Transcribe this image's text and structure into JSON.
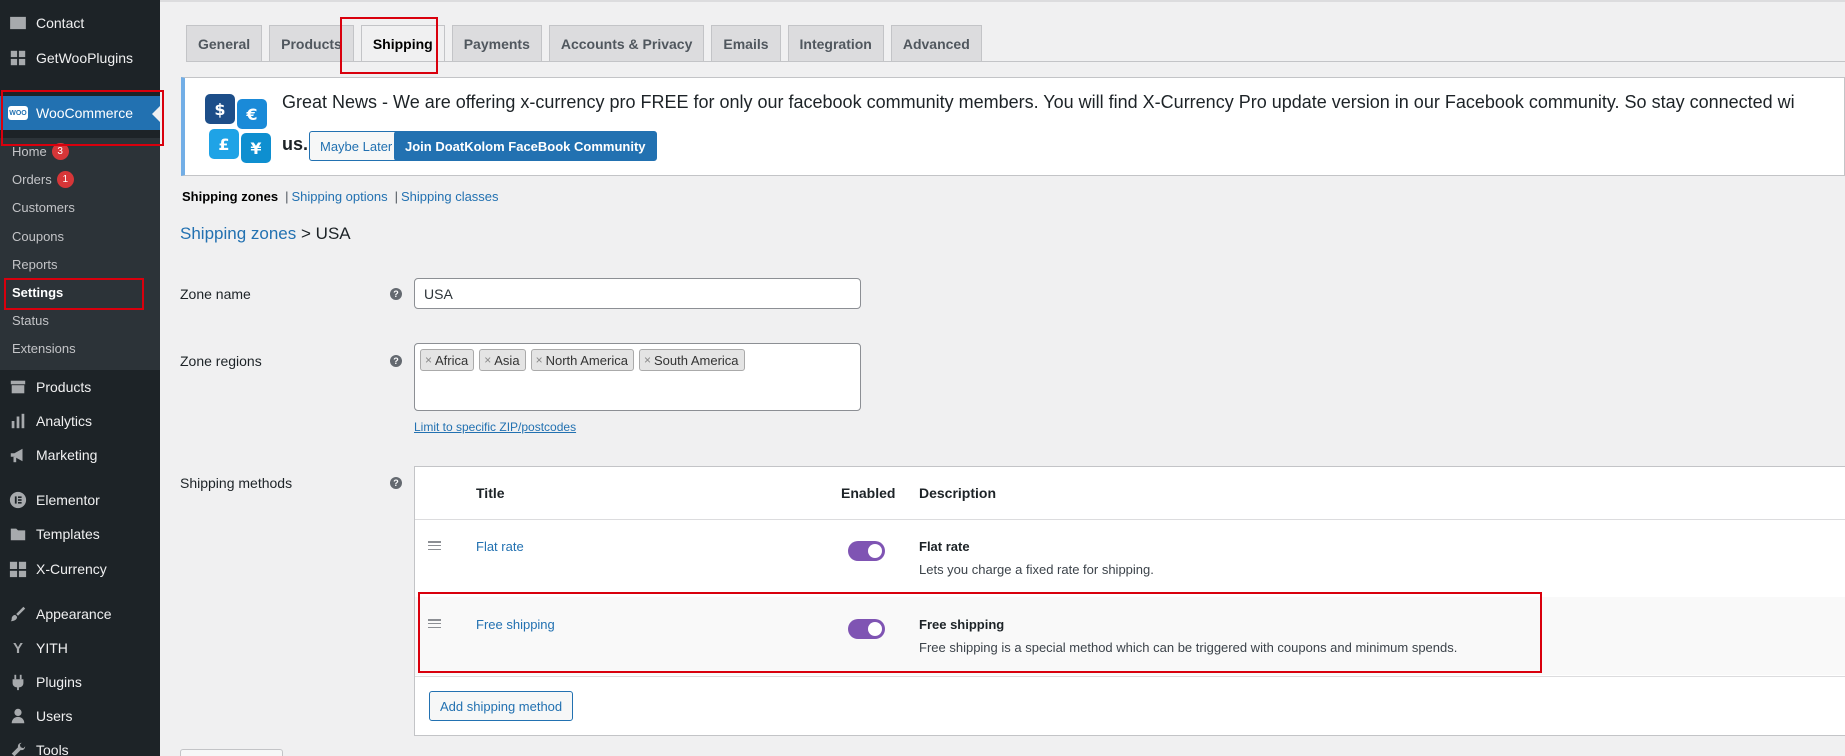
{
  "sidebar": {
    "top_items": [
      {
        "label": "Contact",
        "icon": "mail-icon"
      },
      {
        "label": "GetWooPlugins",
        "icon": "plugin-grid-icon"
      },
      {
        "label": "WooCommerce",
        "icon": "woocommerce-icon",
        "active": true
      }
    ],
    "woo_submenu": [
      {
        "label": "Home",
        "badge": "3"
      },
      {
        "label": "Orders",
        "badge": "1"
      },
      {
        "label": "Customers"
      },
      {
        "label": "Coupons"
      },
      {
        "label": "Reports"
      },
      {
        "label": "Settings",
        "current": true
      },
      {
        "label": "Status"
      },
      {
        "label": "Extensions"
      }
    ],
    "bottom_items": [
      {
        "label": "Products",
        "icon": "archive-icon"
      },
      {
        "label": "Analytics",
        "icon": "bar-chart-icon"
      },
      {
        "label": "Marketing",
        "icon": "megaphone-icon"
      },
      {
        "label": "Elementor",
        "icon": "elementor-icon"
      },
      {
        "label": "Templates",
        "icon": "folder-icon"
      },
      {
        "label": "X-Currency",
        "icon": "currency-icon"
      },
      {
        "label": "Appearance",
        "icon": "paintbrush-icon"
      },
      {
        "label": "YITH",
        "icon": "yith-icon"
      },
      {
        "label": "Plugins",
        "icon": "plug-icon"
      },
      {
        "label": "Users",
        "icon": "user-icon"
      },
      {
        "label": "Tools",
        "icon": "wrench-icon"
      }
    ],
    "woo_logo_text": "WOO"
  },
  "tabs": [
    {
      "label": "General"
    },
    {
      "label": "Products"
    },
    {
      "label": "Shipping",
      "active": true
    },
    {
      "label": "Payments"
    },
    {
      "label": "Accounts & Privacy"
    },
    {
      "label": "Emails"
    },
    {
      "label": "Integration"
    },
    {
      "label": "Advanced"
    }
  ],
  "notice": {
    "text": "Great News - We are offering x-currency pro FREE for only our facebook community members. You will find X-Currency Pro update version in our Facebook community. So stay connected wi",
    "text_end": "us.",
    "maybe_later": "Maybe Later",
    "join_button": "Join DoatKolom FaceBook Community",
    "coins": [
      "$",
      "€",
      "£",
      "¥"
    ],
    "coin_colors": {
      "dollar": "#1d4e89",
      "euro": "#1a8ad8",
      "pound": "#1fa3e6",
      "yen": "#0e8fd0"
    }
  },
  "subnav": {
    "current": "Shipping zones",
    "options": "Shipping options",
    "classes": "Shipping classes"
  },
  "breadcrumb": {
    "link": "Shipping zones",
    "separator": ">",
    "current": "USA"
  },
  "form": {
    "zone_name_label": "Zone name",
    "zone_name_value": "USA",
    "zone_regions_label": "Zone regions",
    "regions": [
      "Africa",
      "Asia",
      "North America",
      "South America"
    ],
    "limit_link": "Limit to specific ZIP/postcodes",
    "shipping_methods_label": "Shipping methods",
    "help_glyph": "?"
  },
  "methods_table": {
    "headers": {
      "title": "Title",
      "enabled": "Enabled",
      "description": "Description"
    },
    "rows": [
      {
        "title": "Flat rate",
        "enabled": true,
        "desc_title": "Flat rate",
        "desc": "Lets you charge a fixed rate for shipping."
      },
      {
        "title": "Free shipping",
        "enabled": true,
        "desc_title": "Free shipping",
        "desc": "Free shipping is a special method which can be triggered with coupons and minimum spends."
      }
    ],
    "add_button": "Add shipping method"
  },
  "colors": {
    "accent": "#2271b1",
    "sidebar_bg": "#1d2327",
    "toggle_on": "#7f54b3",
    "highlight_box": "#d9000d",
    "badge": "#d63638"
  }
}
